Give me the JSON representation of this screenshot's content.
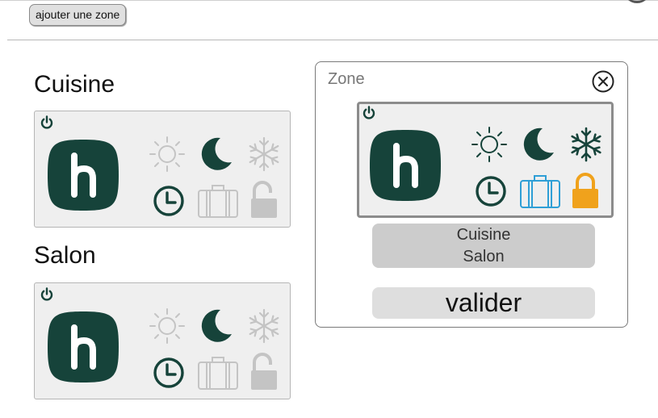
{
  "toolbar": {
    "add_zone_label": "ajouter une zone"
  },
  "zones": [
    {
      "name": "Cuisine"
    },
    {
      "name": "Salon"
    }
  ],
  "panel": {
    "title": "Zone",
    "selected_zones": [
      "Cuisine",
      "Salon"
    ],
    "submit_label": "valider"
  },
  "colors": {
    "brand_dark_green": "#16433a",
    "inactive_grey": "#c4c4c4",
    "travel_blue": "#2f9fd6",
    "lock_orange": "#f0a21c"
  },
  "icons": {
    "card": [
      "power-icon",
      "h-logo-icon",
      "sun-icon",
      "moon-icon",
      "snowflake-icon",
      "clock-icon",
      "suitcase-icon",
      "lock-icon"
    ],
    "panel": [
      "close-icon"
    ]
  }
}
